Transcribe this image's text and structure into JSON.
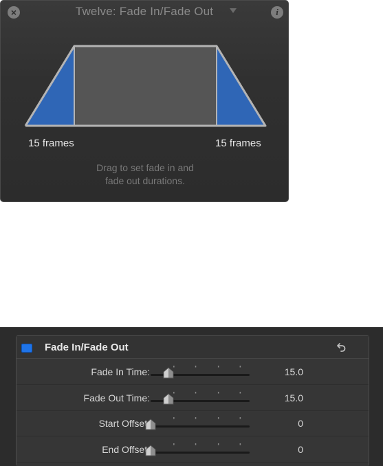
{
  "hud": {
    "title": "Twelve: Fade In/Fade Out",
    "close_icon": "close-circle-icon",
    "info_icon": "info-circle-icon",
    "dropdown_icon": "chevron-down-icon",
    "fade_in_label": "15 frames",
    "fade_out_label": "15 frames",
    "hint_line1": "Drag to set fade in and",
    "hint_line2": "fade out durations.",
    "colors": {
      "ramp_blue": "#2f66b6",
      "body_gray": "#555555",
      "outline": "#b4b4b4"
    }
  },
  "inspector": {
    "title": "Fade In/Fade Out",
    "enabled": true,
    "reset_icon": "reset-arrow-icon",
    "params": [
      {
        "label": "Fade In Time:",
        "value": "15.0",
        "level": 0.18
      },
      {
        "label": "Fade Out Time:",
        "value": "15.0",
        "level": 0.18
      },
      {
        "label": "Start Offset:",
        "value": "0",
        "level": 0.0
      },
      {
        "label": "End Offset:",
        "value": "0",
        "level": 0.0
      }
    ],
    "colors": {
      "checkbox_blue": "#1f74e8"
    }
  }
}
